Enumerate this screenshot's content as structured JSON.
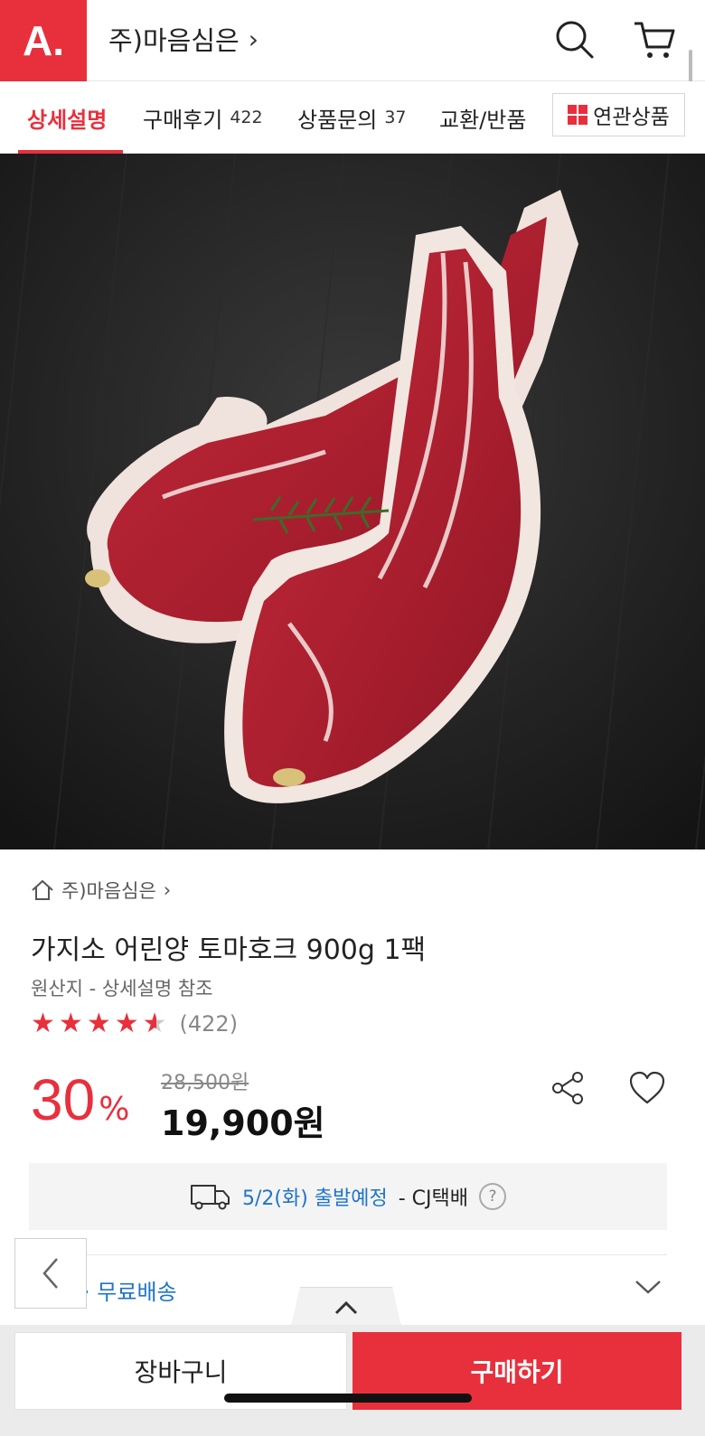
{
  "header": {
    "logo_text": "A.",
    "store_title": "주)마음심은",
    "store_chevron": "›"
  },
  "tabs": [
    {
      "label": "상세설명",
      "count": ""
    },
    {
      "label": "구매후기",
      "count": "422"
    },
    {
      "label": "상품문의",
      "count": "37"
    },
    {
      "label": "교환/반품",
      "count": ""
    }
  ],
  "related_button": {
    "label": "연관상품"
  },
  "product": {
    "store_link": "주)마음심은",
    "title": "가지소 어린양 토마호크 900g 1팩",
    "origin": "원산지 - 상세설명 참조",
    "rating": 4.5,
    "rating_count": "(422)",
    "discount_num": "30",
    "discount_pct": "%",
    "original_price": "28,500원",
    "sale_price": "19,900원"
  },
  "shipping": {
    "date": "5/2(화) 출발예정",
    "carrier": "- CJ택배",
    "help": "?"
  },
  "delivery_fee": {
    "label": "무료배송",
    "prefix": "·"
  },
  "bottom_bar": {
    "cart_label": "장바구니",
    "buy_label": "구매하기"
  },
  "colors": {
    "accent": "#e8303c",
    "link": "#1f74c9"
  }
}
